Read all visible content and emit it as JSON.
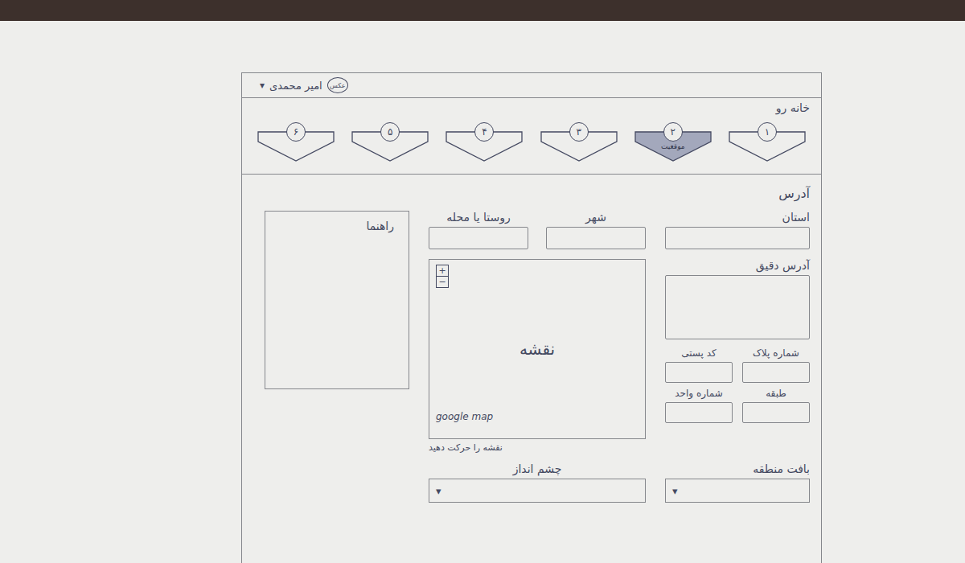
{
  "user": {
    "avatar": "عکس",
    "name": "امیر محمدی",
    "caret": "▾"
  },
  "breadcrumb": "خانه رو",
  "steps": [
    {
      "number": "۱",
      "label": "",
      "selected": false
    },
    {
      "number": "۲",
      "label": "موقعیت",
      "selected": true
    },
    {
      "number": "۳",
      "label": "",
      "selected": false
    },
    {
      "number": "۴",
      "label": "",
      "selected": false
    },
    {
      "number": "۵",
      "label": "",
      "selected": false
    },
    {
      "number": "۶",
      "label": "",
      "selected": false
    }
  ],
  "section_title": "آدرس",
  "province": {
    "label": "استان"
  },
  "locality": [
    {
      "label": "شهر"
    },
    {
      "label": "روستا یا محله"
    }
  ],
  "guide": {
    "title": "راهنما"
  },
  "exact_address": {
    "label": "آدرس دقیق"
  },
  "map": {
    "zoom_in": "+",
    "zoom_out": "−",
    "label": "نقشه",
    "brand": "google map",
    "hint": "نقشه را حرکت دهید"
  },
  "details": [
    {
      "label": "شماره پلاک"
    },
    {
      "label": "کد پستی"
    },
    {
      "label": "طبقه"
    },
    {
      "label": "شماره واحد"
    }
  ],
  "fabric": {
    "label": "بافت منطقه",
    "caret": "▾"
  },
  "view": {
    "label": "چشم انداز",
    "caret": "▾"
  }
}
